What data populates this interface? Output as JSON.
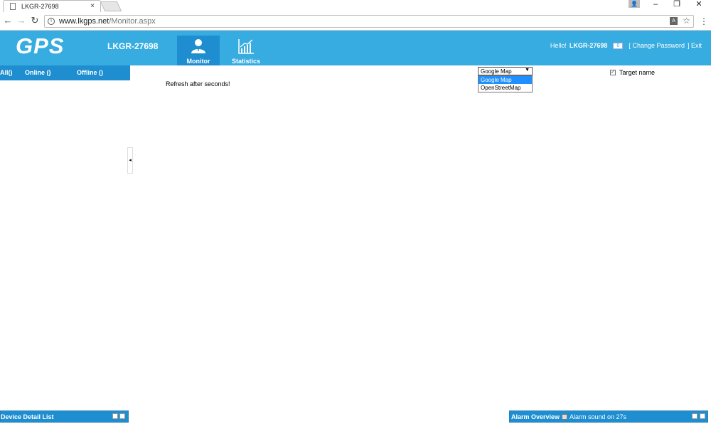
{
  "browser": {
    "tab_title": "LKGR-27698",
    "tab_close": "×",
    "url_host": "www.lkgps.net",
    "url_path": "/Monitor.aspx",
    "window_buttons": [
      "–",
      "❐",
      "✕"
    ]
  },
  "header": {
    "logo": "GPS",
    "account_name": "LKGR-27698",
    "tabs": [
      {
        "label": "Monitor",
        "icon": "user-icon",
        "active": true
      },
      {
        "label": "Statistics",
        "icon": "chart-icon",
        "active": false
      }
    ],
    "hello": "Hello!",
    "username": "LKGR-27698",
    "message_count": "0",
    "change_password": "[ Change Password",
    "exit": "] Exit"
  },
  "left_panel": {
    "filters": {
      "all": "All()",
      "online": "Online ()",
      "offline": "Offline ()"
    }
  },
  "main": {
    "refresh_text": "Refresh after seconds!",
    "map_select_value": "Google Map",
    "map_options": [
      "Google Map",
      "OpenStreetMap"
    ],
    "target_name_label": "Target name",
    "target_name_checked": true
  },
  "bottom": {
    "device_detail_title": "Device Detail List",
    "alarm_overview_title": "Alarm Overview",
    "alarm_sound_label": "Alarm sound on 27s"
  },
  "colors": {
    "header_bg": "#37ace0",
    "accent_dark": "#1e8ed0"
  }
}
